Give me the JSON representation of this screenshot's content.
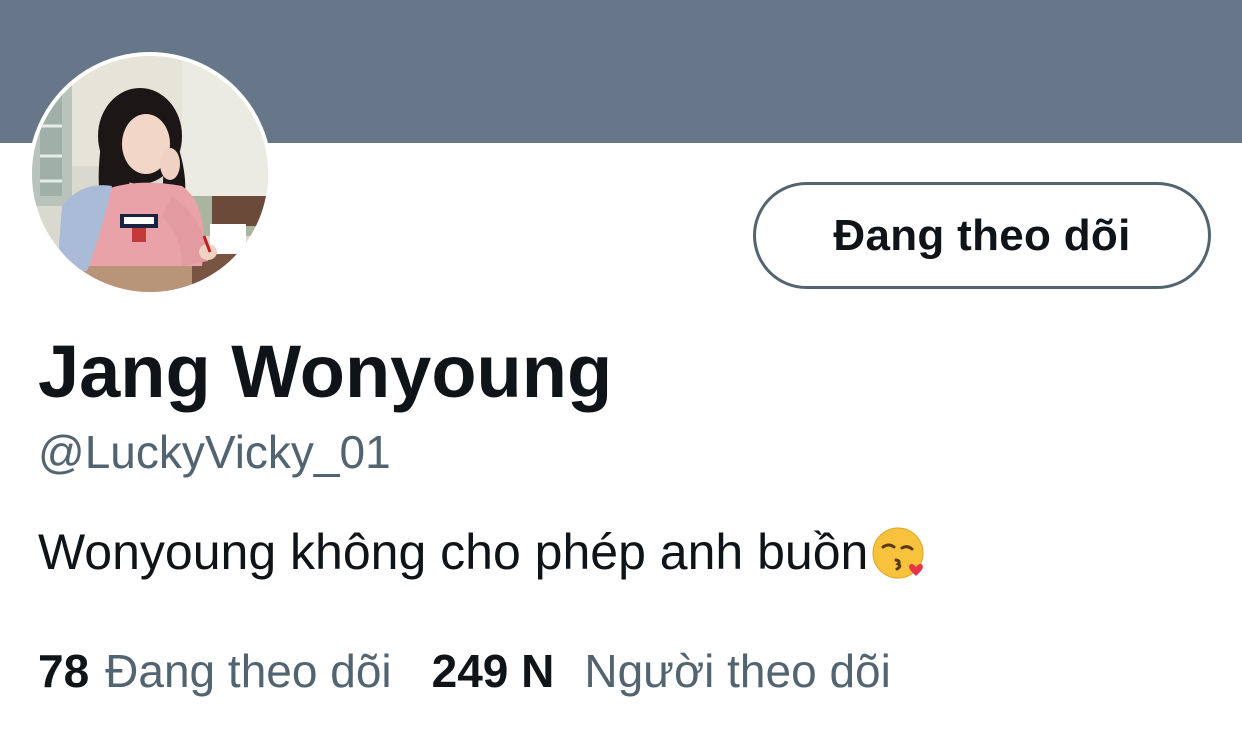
{
  "profile": {
    "display_name": "Jang Wonyoung",
    "handle": "@LuckyVicky_01",
    "bio": "Wonyoung không cho phép anh buồn",
    "bio_emoji": "face-blowing-a-kiss-icon",
    "avatar": "profile-photo"
  },
  "actions": {
    "follow_button_label": "Đang theo dõi"
  },
  "stats": {
    "following_count": "78",
    "following_label": "Đang theo dõi",
    "followers_count": "249 N",
    "followers_label": "Người theo dõi"
  },
  "colors": {
    "banner": "#677789",
    "text_primary": "#0f1419",
    "text_secondary": "#536471",
    "button_border": "#536471"
  }
}
